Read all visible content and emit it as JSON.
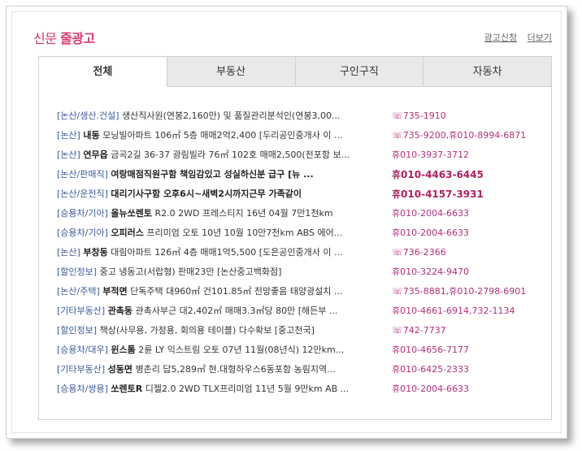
{
  "header": {
    "title_prefix": "신문",
    "title_bold": "줄광고",
    "link_apply": "광고신청",
    "link_more": "더보기"
  },
  "tabs": [
    {
      "label": "전체",
      "active": true
    },
    {
      "label": "부동산",
      "active": false
    },
    {
      "label": "구인구직",
      "active": false
    },
    {
      "label": "자동차",
      "active": false
    }
  ],
  "rows": [
    {
      "cat": "[논산/생산.건설]",
      "emph": "",
      "desc": "생산직사원(연봉2,160만) 및 품질관리분석인(연봉3,00...",
      "phone": "☏735-1910",
      "bold": false
    },
    {
      "cat": "[논산]",
      "emph": "내동",
      "desc": "모닝빌아파트 106㎡ 5층 매매2억2,400 [두리공인중개사 이 ...",
      "phone": "☏735-9200,휴010-8994-6871",
      "bold": false
    },
    {
      "cat": "[논산]",
      "emph": "연무읍",
      "desc": "금곡2길 36-37 광림빌라 76㎡ 102호 매매2,500(전포함 보...",
      "phone": "휴010-3937-3712",
      "bold": false
    },
    {
      "cat": "[논산/판매직]",
      "emph": "",
      "desc": "여랑매점직원구함 책임감있고 성실하신분 급구 [뉴 ...",
      "phone": "휴010-4463-6445",
      "bold": true
    },
    {
      "cat": "[논산/운전직]",
      "emph": "",
      "desc": "대리기사구함 오후6시~새벽2시까지근무 가족같이",
      "phone": "휴010-4157-3931",
      "bold": true
    },
    {
      "cat": "[승용차/기아]",
      "emph": "올뉴쏘렌토",
      "desc": "R2.0 2WD 프레스티지 16년 04월 7만1천km",
      "phone": "휴010-2004-6633",
      "bold": false
    },
    {
      "cat": "[승용차/기아]",
      "emph": "오피러스",
      "desc": "프리미엄 오토 10년 10월 10만7천km ABS 에어...",
      "phone": "휴010-2004-6633",
      "bold": false
    },
    {
      "cat": "[논산]",
      "emph": "부창동",
      "desc": "대림아파트 126㎡ 4층 매매1억5,500 [도은공인중개사 이 ...",
      "phone": "☏736-2366",
      "bold": false
    },
    {
      "cat": "[할인정보]",
      "emph": "",
      "desc": "중고 냉동고(서랍형) 판매23만 [논산중고백화점]",
      "phone": "휴010-3224-9470",
      "bold": false
    },
    {
      "cat": "[논산/주택]",
      "emph": "부적면",
      "desc": "단독주택 대960㎡ 건101.85㎡ 전망좋음 태양광설치 ...",
      "phone": "☏735-8881,휴010-2798-6901",
      "bold": false
    },
    {
      "cat": "[기타부동산]",
      "emph": "관촉동",
      "desc": "관촉사부근 대2,402㎡ 매매3.3㎡당 80만 [해든부 ...",
      "phone": "휴010-4661-6914,732-1134",
      "bold": false
    },
    {
      "cat": "[할인정보]",
      "emph": "",
      "desc": "책상(사무용, 가정용, 회의용 테이블) 다수확보 [중고천국]",
      "phone": "☏742-7737",
      "bold": false
    },
    {
      "cat": "[승용차/대우]",
      "emph": "윈스톰",
      "desc": "2륜 LY 익스트림 오토 07년 11월(08년식) 12만km...",
      "phone": "휴010-4656-7177",
      "bold": false
    },
    {
      "cat": "[기타부동산]",
      "emph": "성동면",
      "desc": "병촌리 답5,289㎡ 현.대형하우스6동포함 농림지역...",
      "phone": "휴010-6425-2333",
      "bold": false
    },
    {
      "cat": "[승용차/쌍용]",
      "emph": "쏘렌토R",
      "desc": "디젤2.0 2WD TLX프리미엄 11년 5월 9만km AB ...",
      "phone": "휴010-2004-6633",
      "bold": false
    }
  ]
}
